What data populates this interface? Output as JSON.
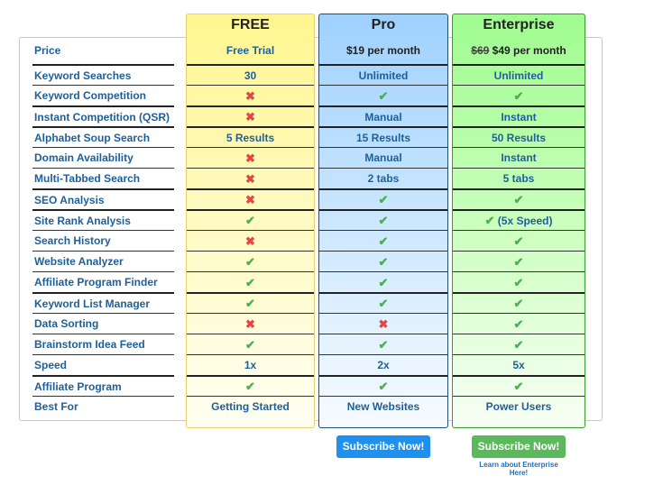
{
  "features": {
    "price_label": "Price",
    "rows": [
      {
        "label": "Keyword Searches",
        "thick": true
      },
      {
        "label": "Keyword Competition",
        "thick": false
      },
      {
        "label": "Instant Competition (QSR)",
        "thick": true
      },
      {
        "label": "Alphabet Soup Search",
        "thick": true
      },
      {
        "label": "Domain Availability",
        "thick": false
      },
      {
        "label": "Multi-Tabbed Search",
        "thick": false
      },
      {
        "label": "SEO Analysis",
        "thick": true
      },
      {
        "label": "Site Rank Analysis",
        "thick": true
      },
      {
        "label": "Search History",
        "thick": false
      },
      {
        "label": "Website Analyzer",
        "thick": false
      },
      {
        "label": "Affiliate Program Finder",
        "thick": false
      },
      {
        "label": "Keyword List Manager",
        "thick": true
      },
      {
        "label": "Data Sorting",
        "thick": false
      },
      {
        "label": "Brainstorm Idea Feed",
        "thick": false
      },
      {
        "label": "Speed",
        "thick": false
      },
      {
        "label": "Affiliate Program",
        "thick": true
      },
      {
        "label": "Best For",
        "thick": false
      }
    ]
  },
  "plans": [
    {
      "id": "free",
      "name": "FREE",
      "price": "Free Trial",
      "old_price": "",
      "cells": [
        "30",
        "cross",
        "cross",
        "5 Results",
        "cross",
        "cross",
        "cross",
        "check",
        "cross",
        "check",
        "check",
        "check",
        "cross",
        "check",
        "1x",
        "check",
        "Getting Started"
      ]
    },
    {
      "id": "pro",
      "name": "Pro",
      "price": "$19 per month",
      "old_price": "",
      "cells": [
        "Unlimited",
        "check",
        "Manual",
        "15 Results",
        "Manual",
        "2 tabs",
        "check",
        "check",
        "check",
        "check",
        "check",
        "check",
        "cross",
        "check",
        "2x",
        "check",
        "New Websites"
      ],
      "button": "Subscribe Now!"
    },
    {
      "id": "ent",
      "name": "Enterprise",
      "price": "$49 per month",
      "old_price": "$69",
      "cells": [
        "Unlimited",
        "check",
        "Instant",
        "50 Results",
        "Instant",
        "5 tabs",
        "check",
        "check|(5x Speed)",
        "check",
        "check",
        "check",
        "check",
        "check",
        "check",
        "5x",
        "check",
        "Power Users"
      ],
      "button": "Subscribe Now!",
      "link": "Learn about Enterprise Here!"
    }
  ],
  "icons": {
    "check": "✔",
    "cross": "✖"
  },
  "colors": {
    "free_accent": "#fff690",
    "pro_accent": "#9fd1ff",
    "ent_accent": "#9ffc8f",
    "pro_button": "#1e90f0",
    "ent_button": "#5cb85c",
    "text_blue": "#1f5f99"
  }
}
